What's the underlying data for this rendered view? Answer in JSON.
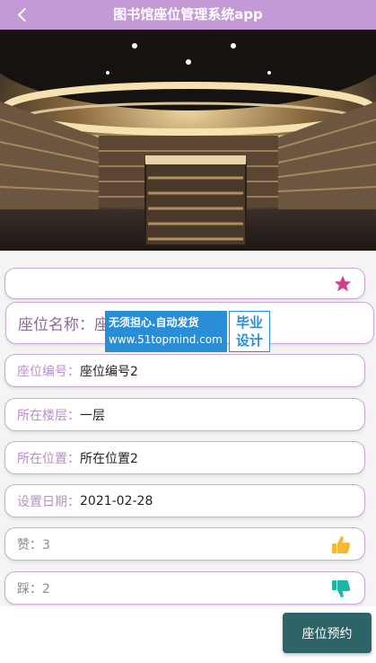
{
  "header": {
    "title": "图书馆座位管理系统app"
  },
  "seat": {
    "name_label": "座位名称：",
    "name_value": "座",
    "fields": [
      {
        "label": "座位编号：",
        "value": "座位编号2"
      },
      {
        "label": "所在楼层：",
        "value": "一层"
      },
      {
        "label": "所在位置：",
        "value": "所在位置2"
      },
      {
        "label": "设置日期：",
        "value": "2021-02-28"
      }
    ],
    "likes": "赞：3",
    "dislikes": "踩：2"
  },
  "watermark": {
    "line1": "无须担心.自动发货",
    "line2": "www.51topmind.com",
    "side": "毕业设计"
  },
  "actions": {
    "reserve_label": "座位预约"
  },
  "colors": {
    "header": "#c49ad6",
    "label": "#b98ec7",
    "star": "#d63c8a",
    "like": "#f5b82e",
    "dislike": "#1fb6a8",
    "button": "#2e6468"
  },
  "icons": {
    "back": "chevron-left-icon",
    "favorite": "star-icon",
    "like": "thumbs-up-icon",
    "dislike": "thumbs-down-icon"
  }
}
